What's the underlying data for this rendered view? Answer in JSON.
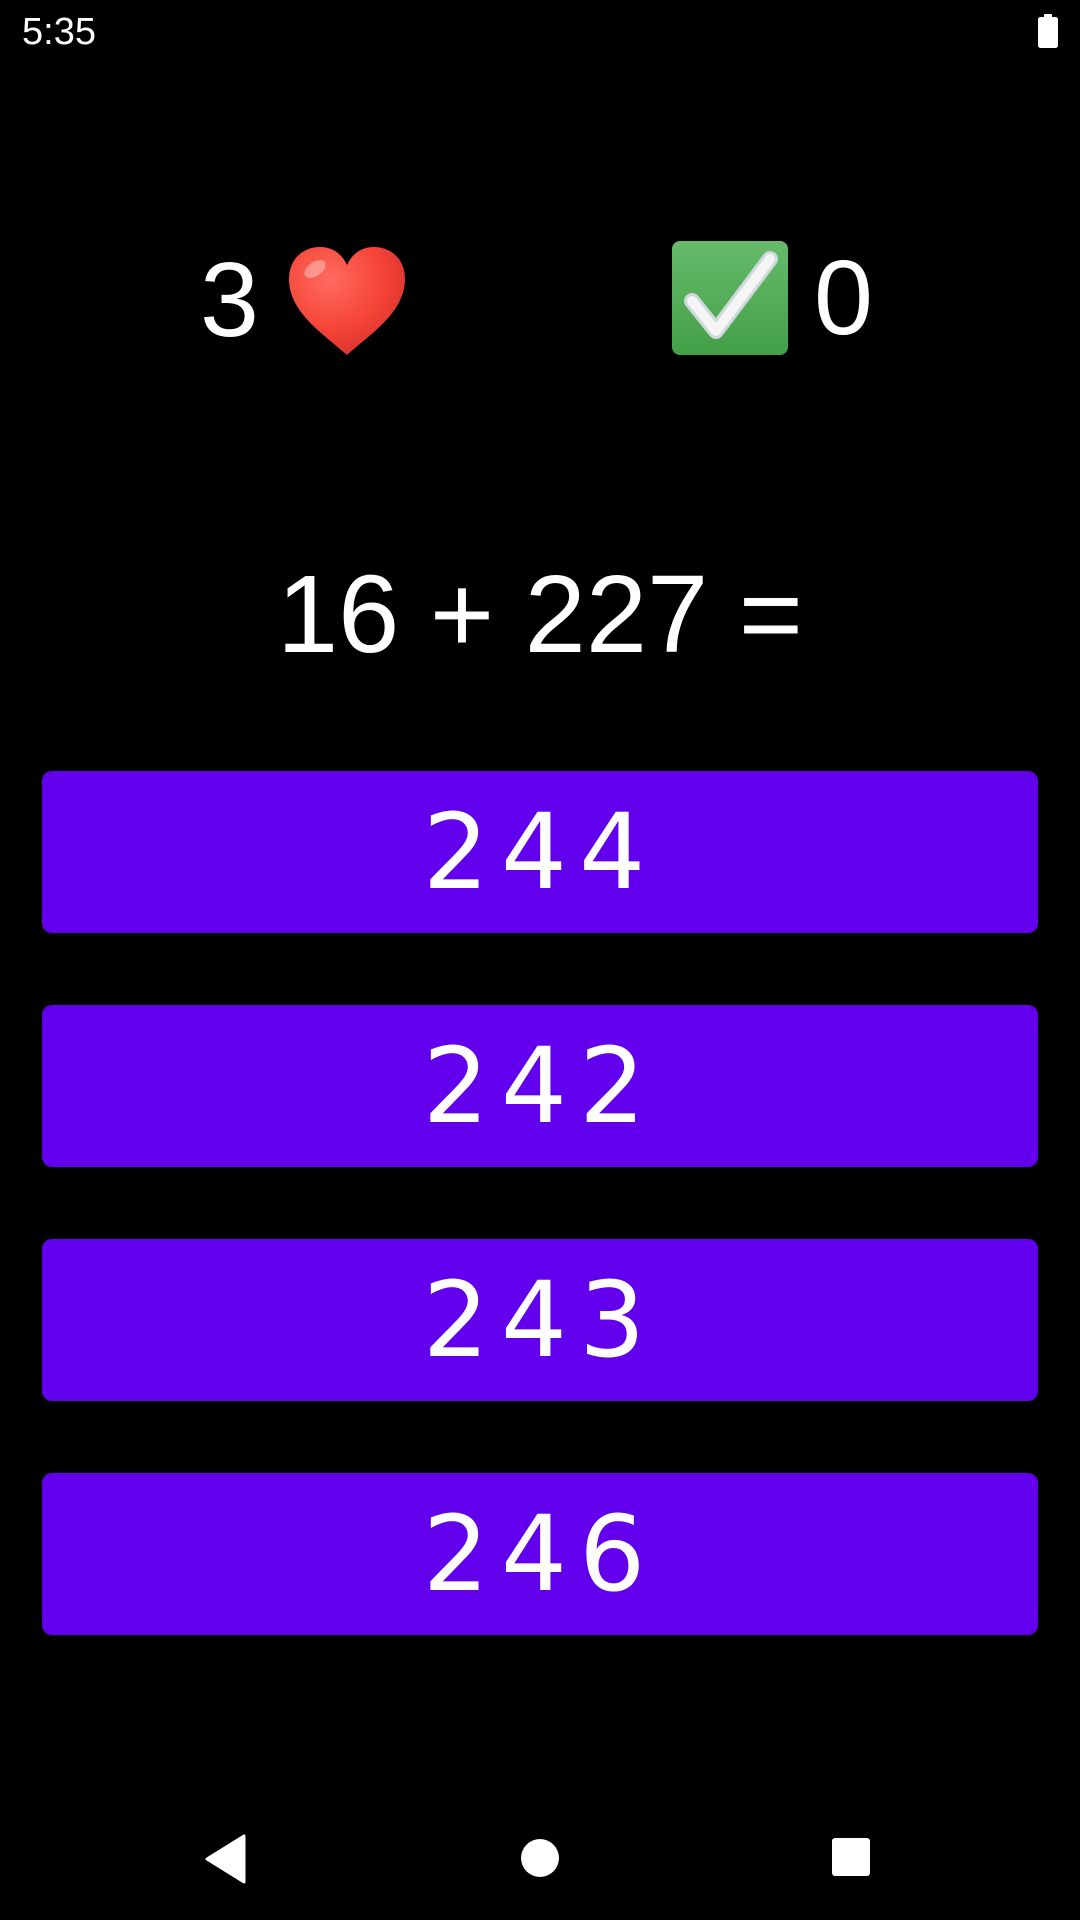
{
  "status_bar": {
    "time": "5:35",
    "battery_icon": "battery-full-icon"
  },
  "stats": {
    "lives": "3",
    "lives_icon": "heart-icon",
    "score": "0",
    "score_icon": "check-mark-icon"
  },
  "question": {
    "text": "16 + 227 ="
  },
  "answers": [
    {
      "label": "244"
    },
    {
      "label": "242"
    },
    {
      "label": "243"
    },
    {
      "label": "246"
    }
  ],
  "colors": {
    "background": "#000000",
    "button": "#6200ee",
    "text": "#ffffff",
    "heart": "#f44336",
    "check": "#4caf50"
  },
  "nav_bar": {
    "back_icon": "back-triangle-icon",
    "home_icon": "home-circle-icon",
    "recents_icon": "recents-square-icon"
  }
}
